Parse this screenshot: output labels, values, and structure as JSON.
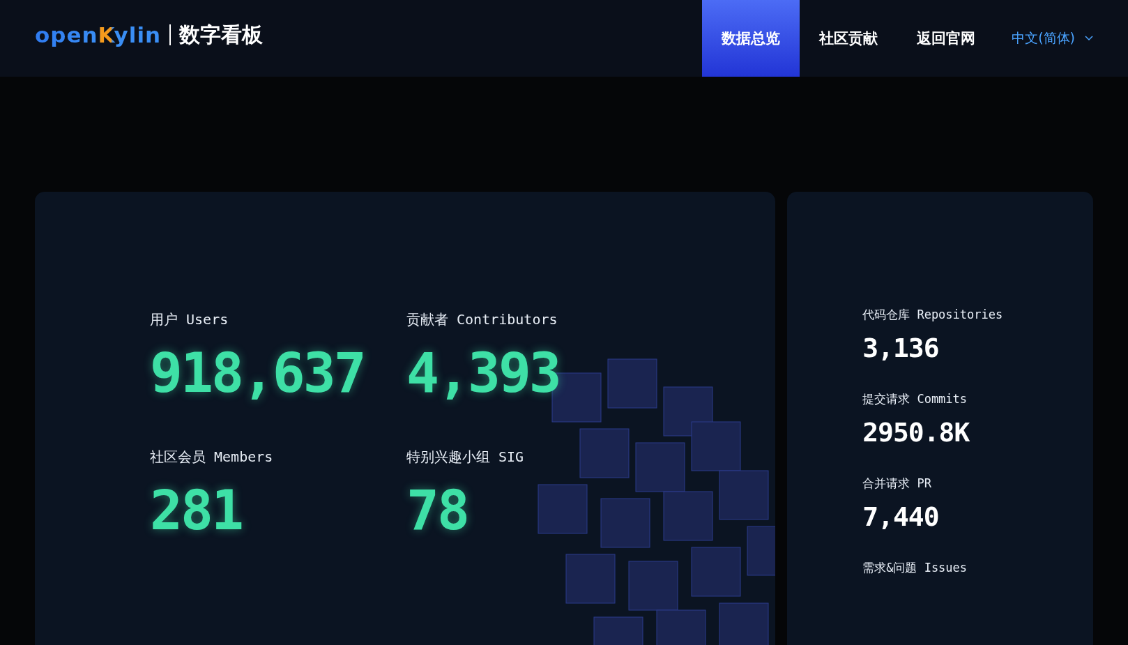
{
  "header": {
    "logo": "openKylin",
    "title": "数字看板",
    "nav": [
      {
        "label": "数据总览",
        "selected": true
      },
      {
        "label": "社区贡献",
        "selected": false
      },
      {
        "label": "返回官网",
        "selected": false
      }
    ],
    "language": "中文(简体)"
  },
  "main_stats": [
    {
      "label": "用户 Users",
      "value": "918,637"
    },
    {
      "label": "贡献者 Contributors",
      "value": "4,393"
    },
    {
      "label": "社区会员 Members",
      "value": "281"
    },
    {
      "label": "特别兴趣小组 SIG",
      "value": "78"
    }
  ],
  "side_stats": [
    {
      "label": "代码仓库 Repositories",
      "value": "3,136"
    },
    {
      "label": "提交请求 Commits",
      "value": "2950.8K"
    },
    {
      "label": "合并请求 PR",
      "value": "7,440"
    },
    {
      "label": "需求&问题 Issues"
    }
  ]
}
